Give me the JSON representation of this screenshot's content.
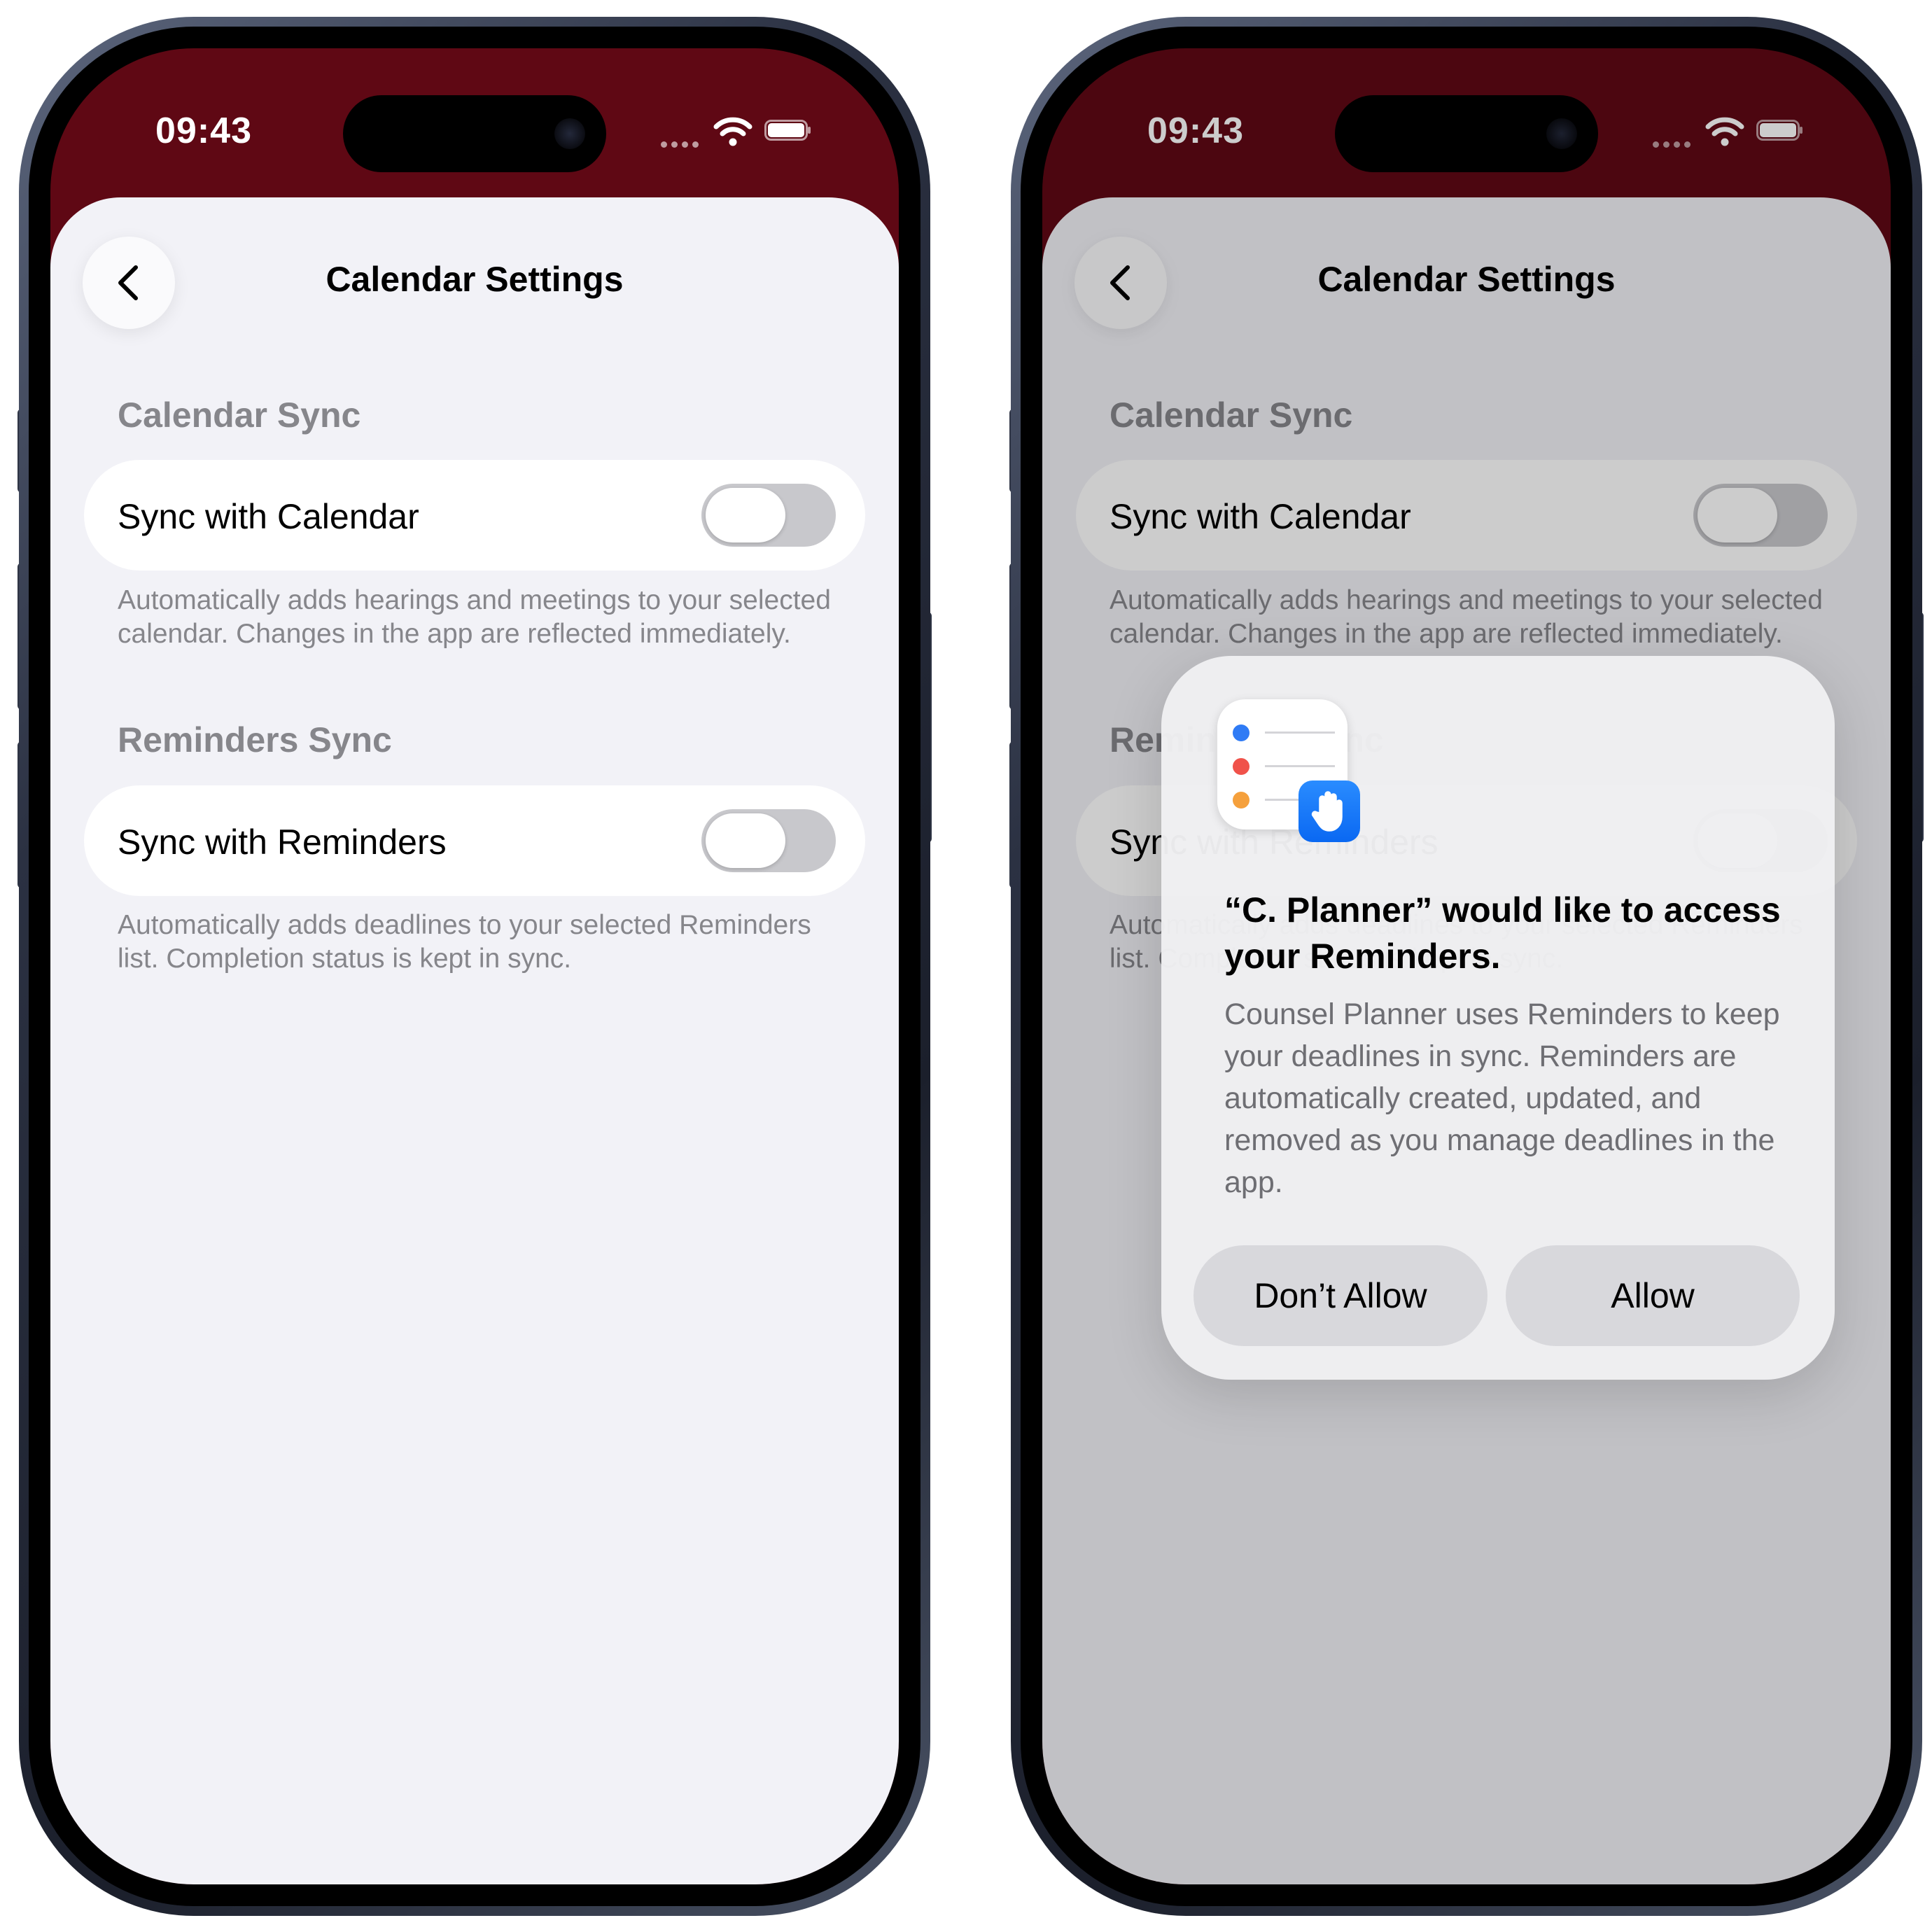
{
  "status": {
    "time": "09:43"
  },
  "screen": {
    "title": "Calendar Settings",
    "sections": [
      {
        "header": "Calendar Sync",
        "row_label": "Sync with Calendar",
        "toggle_on": false,
        "note": "Automatically adds hearings and meetings to your selected calendar. Changes in the app are reflected immediately."
      },
      {
        "header": "Reminders Sync",
        "row_label": "Sync with Reminders",
        "toggle_on": false,
        "note": "Automatically adds deadlines to your selected Reminders list. Completion status is kept in sync."
      }
    ]
  },
  "alert": {
    "title": "“C. Planner” would like to access your Reminders.",
    "message": "Counsel Planner uses Reminders to keep your deadlines in sync. Reminders are automatically created, updated, and removed as you manage deadlines in the app.",
    "deny_label": "Don’t Allow",
    "allow_label": "Allow"
  },
  "icons": {
    "back": "chevron-left-icon",
    "wifi": "wifi-icon",
    "battery": "battery-icon",
    "reminders_app": "reminders-app-icon",
    "privacy": "hand-raised-icon"
  },
  "colors": {
    "header_bar": "#5f0814",
    "background": "#f2f2f7",
    "toggle_off": "#c8c8cc",
    "secondary_text": "#86868b",
    "privacy_badge": "#0a68f2"
  }
}
